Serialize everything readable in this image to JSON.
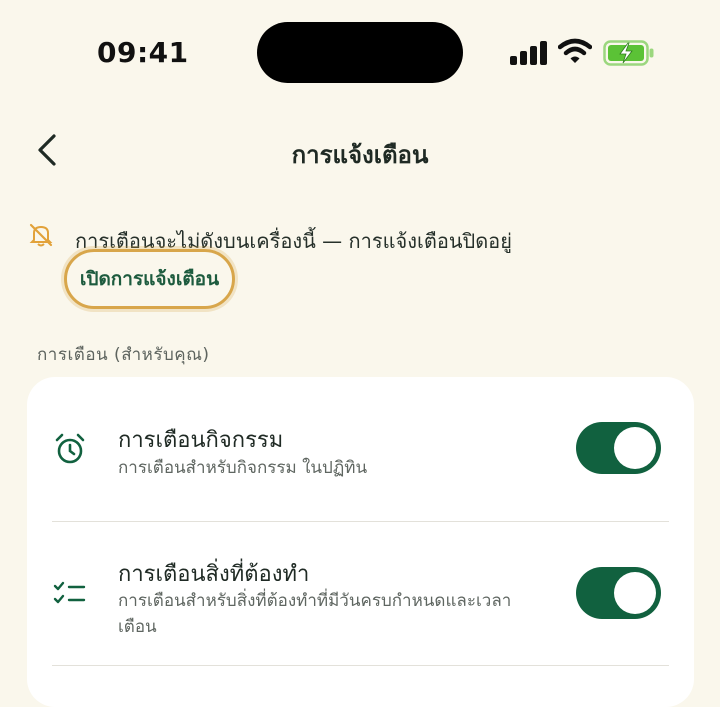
{
  "status_bar": {
    "time": "09:41"
  },
  "header": {
    "title": "การแจ้งเตือน"
  },
  "alert": {
    "message": "การเตือนจะไม่ดังบนเครื่องนี้ — การแจ้งเตือนปิดอยู่",
    "enable_label": "เปิดการแจ้งเตือน"
  },
  "section": {
    "label": "การเตือน (สำหรับคุณ)"
  },
  "items": [
    {
      "title": "การเตือนกิจกรรม",
      "subtitle": "การเตือนสำหรับกิจกรรม ในปฏิทิน",
      "icon": "alarm-clock-icon",
      "enabled": true
    },
    {
      "title": "การเตือนสิ่งที่ต้องทำ",
      "subtitle": "การเตือนสำหรับสิ่งที่ต้องทำที่มีวันครบกำหนดและเวลาเตือน",
      "icon": "checklist-icon",
      "enabled": true
    }
  ],
  "colors": {
    "background": "#FAF7EC",
    "accent": "#11613F",
    "highlight": "#D8A64B",
    "warning_icon": "#E2A23A",
    "battery_green": "#5BC236"
  }
}
